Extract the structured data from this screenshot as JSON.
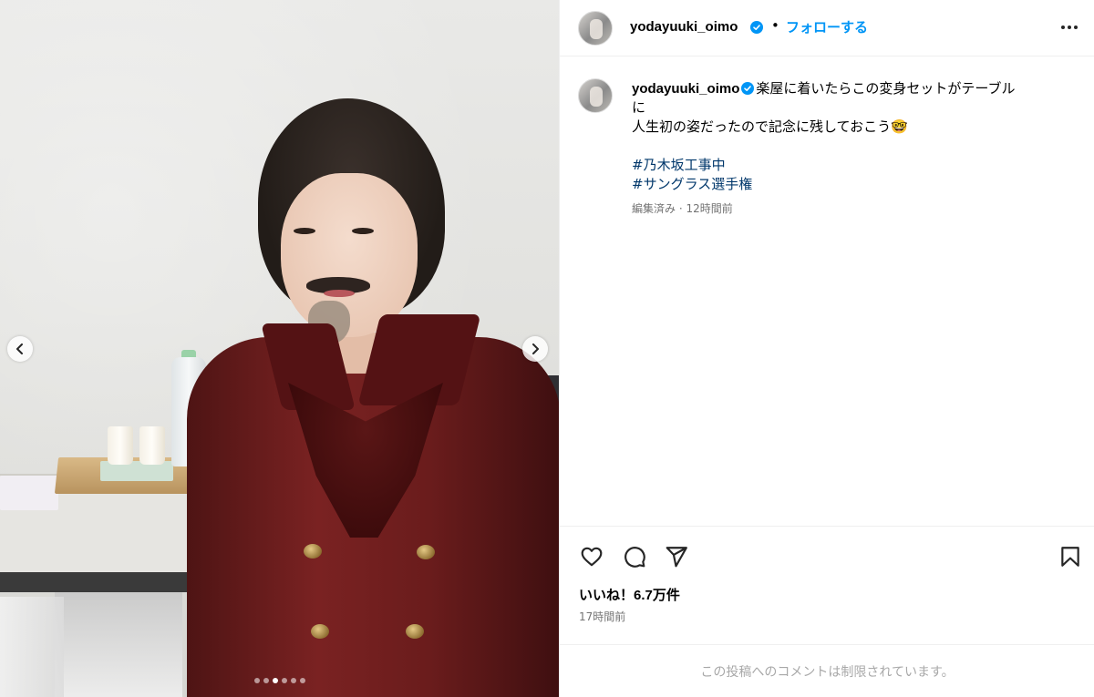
{
  "post": {
    "username": "yodayuuki_oimo",
    "follow_label": "フォローする",
    "separator": "•",
    "caption_line1": "楽屋に着いたらこの変身セットがテーブル",
    "caption_line2": "に",
    "caption_line3": "人生初の姿だったので記念に残しておこう🤓",
    "hashtags": [
      "#乃木坂工事中",
      "#サングラス選手権"
    ],
    "caption_meta": "編集済み · 12時間前",
    "likes": "いいね！6.7万件",
    "timestamp": "17時間前",
    "comments_restricted": "この投稿へのコメントは制限されています。"
  },
  "carousel": {
    "total_slides": 6,
    "active_slide": 2
  },
  "icons": {
    "verified": "verified-badge-icon",
    "more": "more-options-icon",
    "like": "heart-icon",
    "comment": "comment-icon",
    "share": "share-icon",
    "save": "bookmark-icon",
    "prev": "chevron-left-icon",
    "next": "chevron-right-icon"
  },
  "colors": {
    "accent": "#0095f6",
    "hashtag": "#00376b",
    "secondary_text": "#737373",
    "disabled_text": "#a8a8a8",
    "divider": "#efefef"
  }
}
